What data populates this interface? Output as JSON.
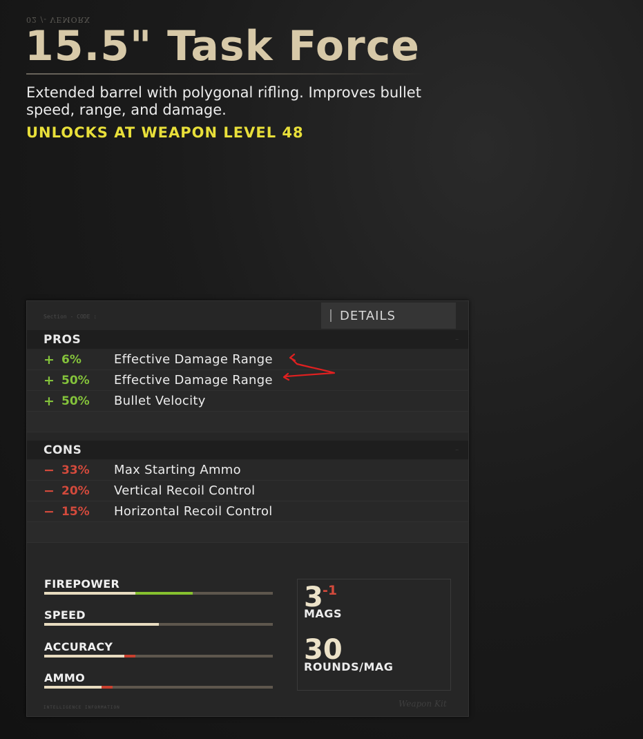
{
  "header": {
    "kicker": "02 /- VEMORX",
    "title": "15.5\" Task Force",
    "description": "Extended barrel with polygonal rifling.  Improves bullet speed, range, and damage.",
    "unlock": "UNLOCKS AT WEAPON LEVEL 48"
  },
  "panel": {
    "section_code": "Section - CODE :",
    "details_tab": "DETAILS",
    "pros": {
      "label": "PROS",
      "items": [
        {
          "sign": "+",
          "value": "6%",
          "stat": "Effective Damage Range"
        },
        {
          "sign": "+",
          "value": "50%",
          "stat": "Effective Damage Range"
        },
        {
          "sign": "+",
          "value": "50%",
          "stat": "Bullet Velocity"
        }
      ]
    },
    "cons": {
      "label": "CONS",
      "items": [
        {
          "sign": "−",
          "value": "33%",
          "stat": "Max Starting Ammo"
        },
        {
          "sign": "−",
          "value": "20%",
          "stat": "Vertical Recoil Control"
        },
        {
          "sign": "−",
          "value": "15%",
          "stat": "Horizontal Recoil Control"
        }
      ]
    },
    "meters": [
      {
        "label": "FIREPOWER",
        "base": 0.4,
        "delta": 0.25,
        "direction": "up"
      },
      {
        "label": "SPEED",
        "base": 0.5,
        "delta": 0,
        "direction": "none"
      },
      {
        "label": "ACCURACY",
        "base": 0.35,
        "delta": 0.05,
        "direction": "down"
      },
      {
        "label": "AMMO",
        "base": 0.25,
        "delta": 0.05,
        "direction": "down"
      }
    ],
    "mags": {
      "value": "3",
      "modifier": "-1",
      "label": "MAGS"
    },
    "rounds": {
      "value": "30",
      "label": "ROUNDS/MAG"
    },
    "footer": "INTELLIGENCE INFORMATION",
    "signature": "Weapon Kit"
  },
  "colors": {
    "pro": "#84c33b",
    "con": "#d34a3c",
    "unlock": "#e8df3a",
    "title": "#d7c9a8",
    "annotation": "#e02020"
  }
}
